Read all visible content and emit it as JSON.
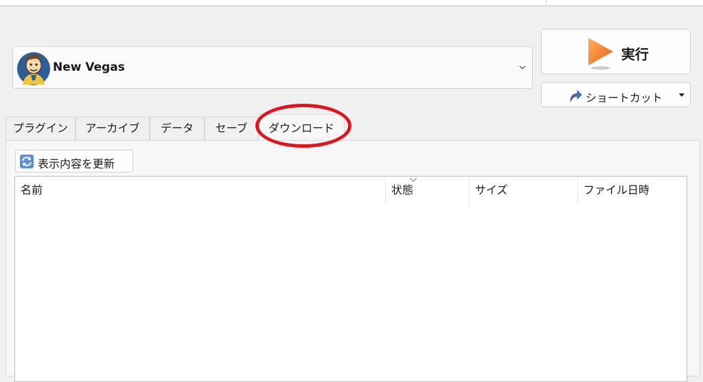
{
  "instance": {
    "name": "New Vegas",
    "icon": "vault-boy-icon"
  },
  "run": {
    "label": "実行",
    "icon": "play-icon"
  },
  "shortcut": {
    "label": "ショートカット",
    "icon": "shortcut-arrow-icon"
  },
  "tabs": [
    {
      "label": "プラグイン"
    },
    {
      "label": "アーカイブ"
    },
    {
      "label": "データ"
    },
    {
      "label": "セーブ"
    },
    {
      "label": "ダウンロード",
      "active": true
    }
  ],
  "downloads": {
    "refresh_label": "表示内容を更新",
    "columns": [
      "名前",
      "状態",
      "サイズ",
      "ファイル日時"
    ],
    "sorted_column": "状態",
    "rows": []
  },
  "colors": {
    "annotation": "#e0141d",
    "play": "#f07820"
  }
}
